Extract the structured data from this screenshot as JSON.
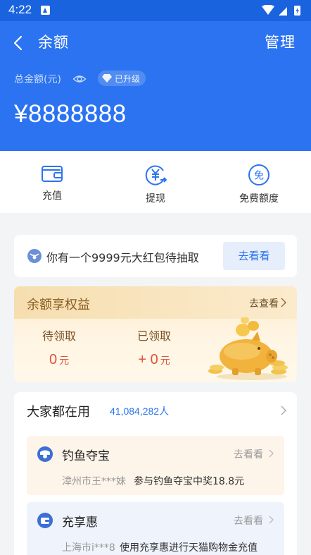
{
  "status_bar": {
    "time": "4:22"
  },
  "header": {
    "title": "余额",
    "manage": "管理",
    "total_label": "总金额(元)",
    "badge": "已升级",
    "amount": "¥8888888",
    "color": "#2b73f0"
  },
  "actions": [
    {
      "label": "充值",
      "icon": "wallet-icon"
    },
    {
      "label": "提现",
      "icon": "yen-withdraw-icon"
    },
    {
      "label": "免费额度",
      "icon": "free-quota-icon"
    }
  ],
  "promo": {
    "text": "你有一个9999元大红包待抽取",
    "button": "去看看"
  },
  "rights": {
    "title": "余额享权益",
    "more": "去查看",
    "pending_label": "待领取",
    "pending_value": "0",
    "claimed_label": "已领取",
    "claimed_value": "+ 0",
    "unit": "元"
  },
  "popular": {
    "title": "大家都在用",
    "count": "41,084,282人",
    "items": [
      {
        "title": "钓鱼夺宝",
        "more": "去看看",
        "user": "漳州市王***妹",
        "desc": "参与钓鱼夺宝中奖18.8元",
        "icon": "fishing-icon"
      },
      {
        "title": "充享惠",
        "more": "去看看",
        "user": "上海市i***8",
        "desc": "使用充享惠进行天猫购物金充值",
        "icon": "recharge-wallet-icon"
      }
    ]
  }
}
